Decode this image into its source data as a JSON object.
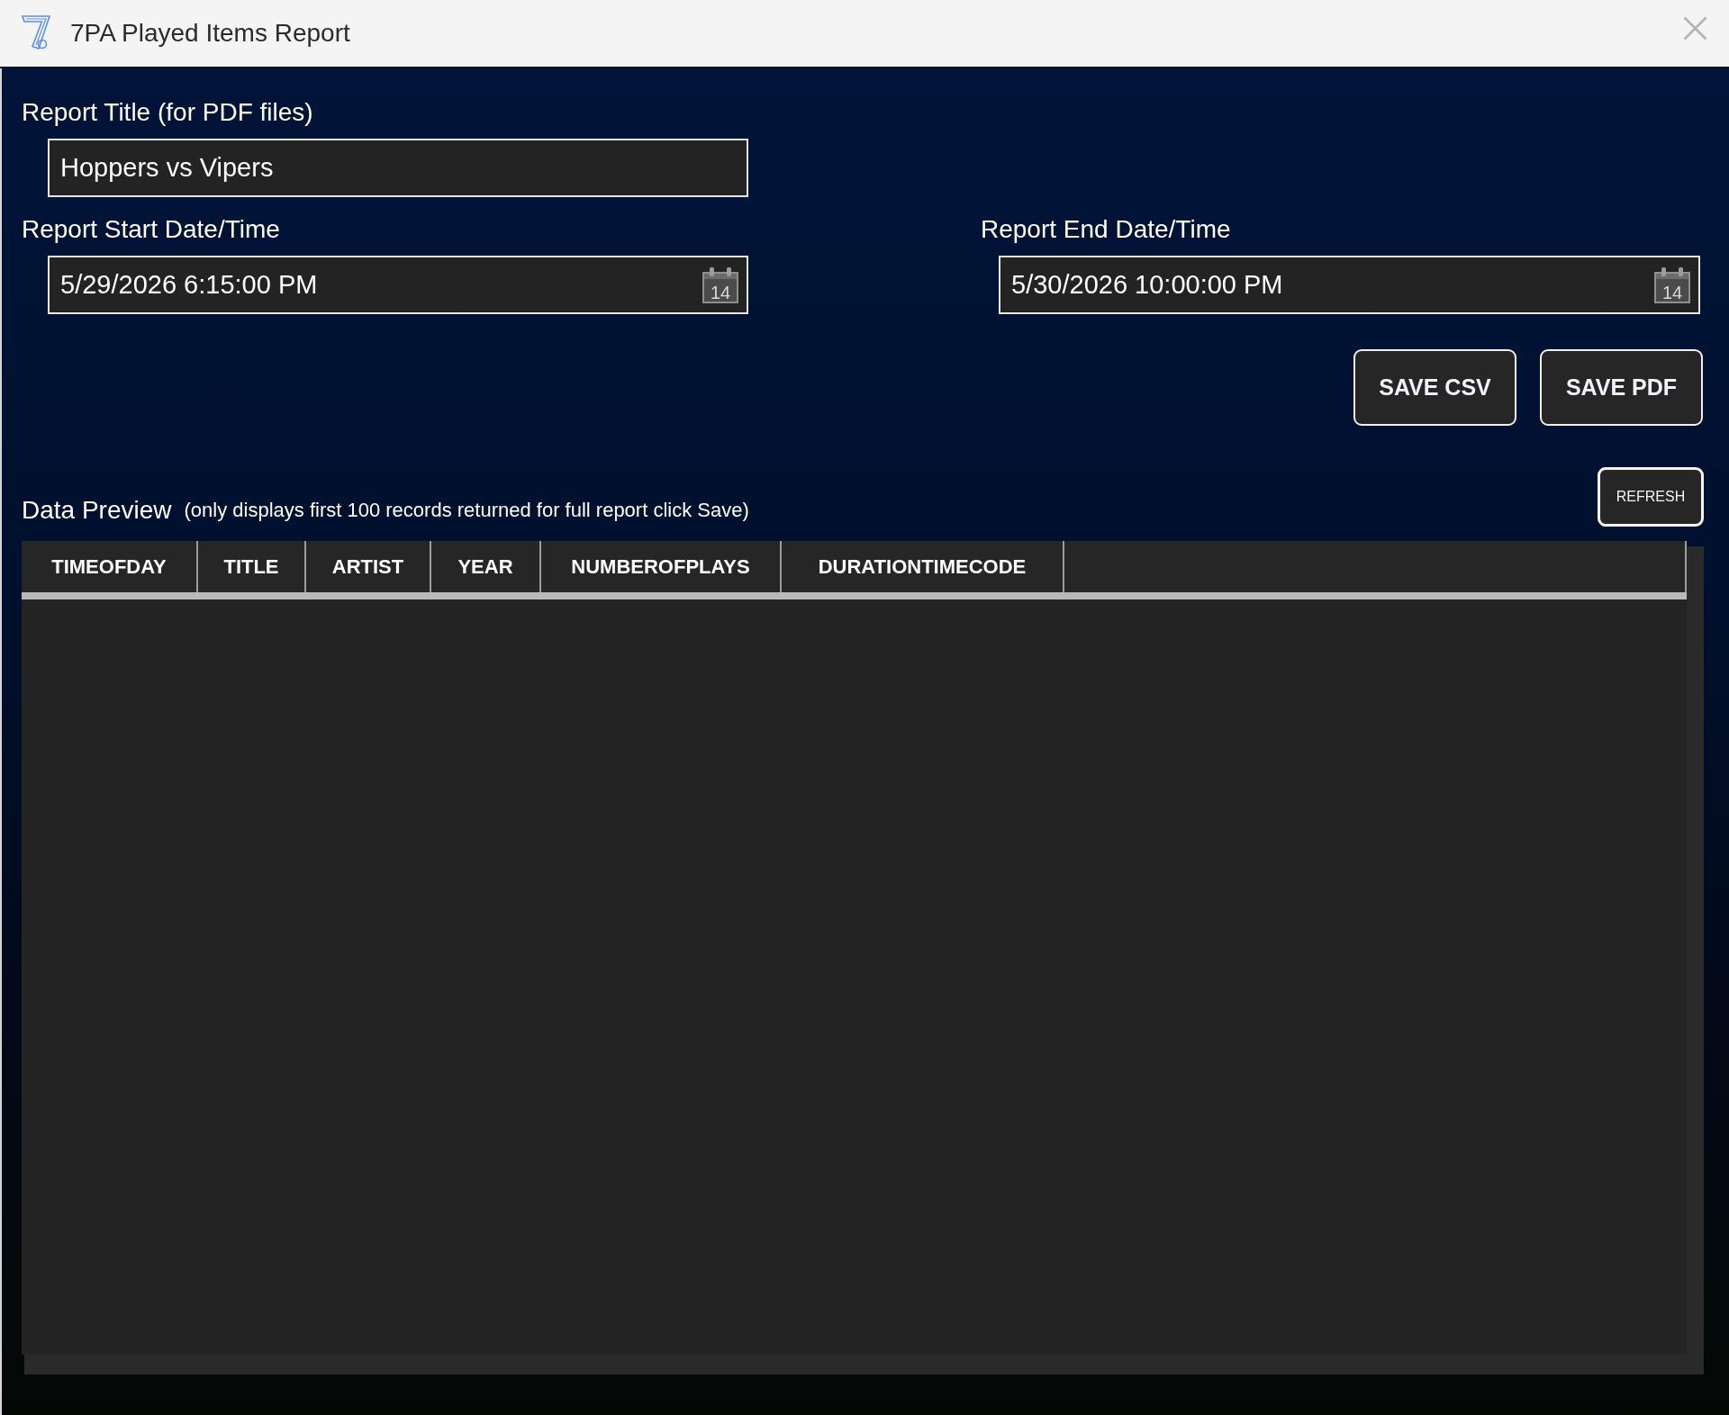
{
  "window": {
    "title": "7PA Played Items Report"
  },
  "report_title": {
    "label": "Report Title (for PDF files)",
    "value": "Hoppers vs Vipers"
  },
  "date_range": [
    {
      "label": "Report Start Date/Time",
      "value": "5/29/2026 6:15:00 PM",
      "calendar_day": "14"
    },
    {
      "label": "Report End Date/Time",
      "value": "5/30/2026 10:00:00 PM",
      "calendar_day": "14"
    }
  ],
  "save_buttons": [
    "SAVE CSV",
    "SAVE PDF"
  ],
  "data_preview": {
    "label": "Data Preview",
    "note": "(only displays first 100 records returned for full report click Save)",
    "refresh_button": "REFRESH"
  },
  "table": {
    "columns": [
      "TIMEOFDAY",
      "TITLE",
      "ARTIST",
      "YEAR",
      "NUMBEROFPLAYS",
      "DURATIONTIMECODE"
    ]
  }
}
